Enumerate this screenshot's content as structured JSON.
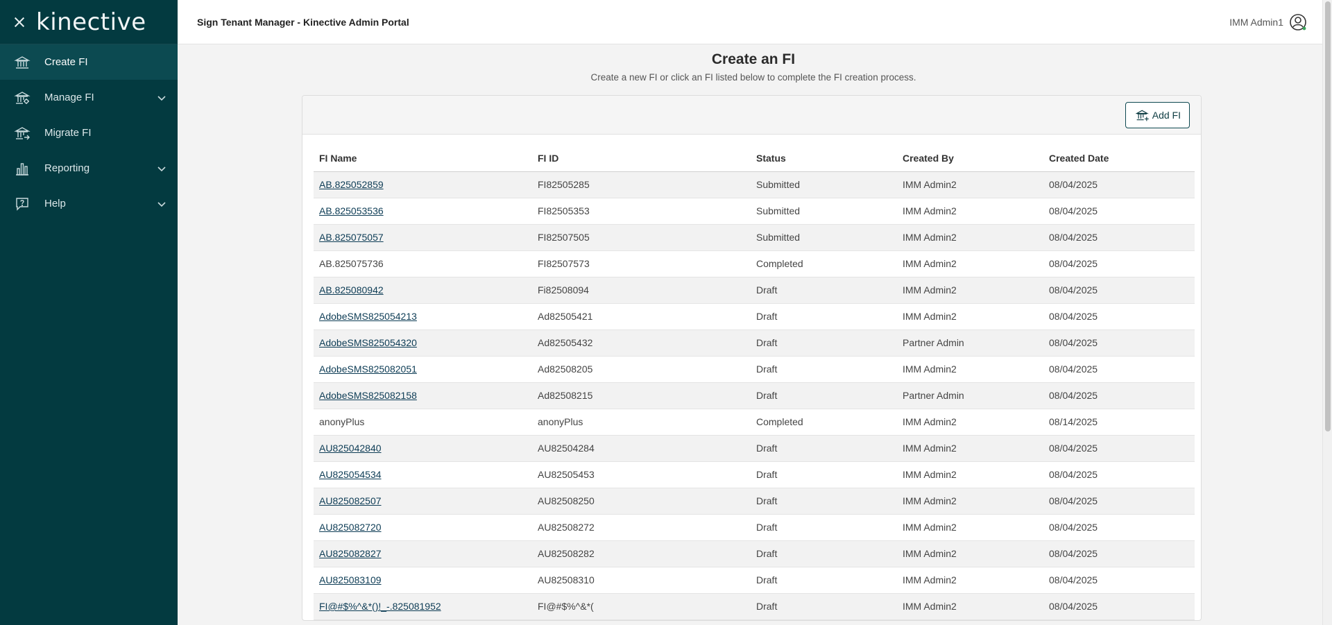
{
  "sidebar": {
    "logo": "kinective",
    "items": [
      {
        "label": "Create FI",
        "icon": "bank-icon"
      },
      {
        "label": "Manage FI",
        "icon": "bank-gear-icon"
      },
      {
        "label": "Migrate FI",
        "icon": "bank-arrow-icon"
      },
      {
        "label": "Reporting",
        "icon": "bar-chart-icon"
      },
      {
        "label": "Help",
        "icon": "help-bubble-icon"
      }
    ]
  },
  "header": {
    "title": "Sign Tenant Manager - Kinective Admin Portal",
    "user": "IMM Admin1"
  },
  "main": {
    "title": "Create an FI",
    "subtitle": "Create a new FI or click an FI listed below to complete the FI creation process.",
    "add_button": "Add FI",
    "columns": [
      "FI Name",
      "FI ID",
      "Status",
      "Created By",
      "Created Date"
    ],
    "rows": [
      {
        "name": "AB.825052859",
        "id": "FI82505285",
        "status": "Submitted",
        "by": "IMM Admin2",
        "date": "08/04/2025",
        "link": true
      },
      {
        "name": "AB.825053536",
        "id": "FI82505353",
        "status": "Submitted",
        "by": "IMM Admin2",
        "date": "08/04/2025",
        "link": true
      },
      {
        "name": "AB.825075057",
        "id": "FI82507505",
        "status": "Submitted",
        "by": "IMM Admin2",
        "date": "08/04/2025",
        "link": true
      },
      {
        "name": "AB.825075736",
        "id": "FI82507573",
        "status": "Completed",
        "by": "IMM Admin2",
        "date": "08/04/2025",
        "link": false
      },
      {
        "name": "AB.825080942",
        "id": "Fi82508094",
        "status": "Draft",
        "by": "IMM Admin2",
        "date": "08/04/2025",
        "link": true
      },
      {
        "name": "AdobeSMS825054213",
        "id": "Ad82505421",
        "status": "Draft",
        "by": "IMM Admin2",
        "date": "08/04/2025",
        "link": true
      },
      {
        "name": "AdobeSMS825054320",
        "id": "Ad82505432",
        "status": "Draft",
        "by": "Partner Admin",
        "date": "08/04/2025",
        "link": true
      },
      {
        "name": "AdobeSMS825082051",
        "id": "Ad82508205",
        "status": "Draft",
        "by": "IMM Admin2",
        "date": "08/04/2025",
        "link": true
      },
      {
        "name": "AdobeSMS825082158",
        "id": "Ad82508215",
        "status": "Draft",
        "by": "Partner Admin",
        "date": "08/04/2025",
        "link": true
      },
      {
        "name": "anonyPlus",
        "id": "anonyPlus",
        "status": "Completed",
        "by": "IMM Admin2",
        "date": "08/14/2025",
        "link": false
      },
      {
        "name": "AU825042840",
        "id": "AU82504284",
        "status": "Draft",
        "by": "IMM Admin2",
        "date": "08/04/2025",
        "link": true
      },
      {
        "name": "AU825054534",
        "id": "AU82505453",
        "status": "Draft",
        "by": "IMM Admin2",
        "date": "08/04/2025",
        "link": true
      },
      {
        "name": "AU825082507",
        "id": "AU82508250",
        "status": "Draft",
        "by": "IMM Admin2",
        "date": "08/04/2025",
        "link": true
      },
      {
        "name": "AU825082720",
        "id": "AU82508272",
        "status": "Draft",
        "by": "IMM Admin2",
        "date": "08/04/2025",
        "link": true
      },
      {
        "name": "AU825082827",
        "id": "AU82508282",
        "status": "Draft",
        "by": "IMM Admin2",
        "date": "08/04/2025",
        "link": true
      },
      {
        "name": "AU825083109",
        "id": "AU82508310",
        "status": "Draft",
        "by": "IMM Admin2",
        "date": "08/04/2025",
        "link": true
      },
      {
        "name": "FI@#$%^&*()!_-.825081952",
        "id": "FI@#$%^&*(",
        "status": "Draft",
        "by": "IMM Admin2",
        "date": "08/04/2025",
        "link": true
      }
    ]
  },
  "colors": {
    "sidebar_bg": "#033a40",
    "sidebar_active": "#0c4a51",
    "link": "#0d3c55",
    "row_alt": "#f2f2f2"
  }
}
